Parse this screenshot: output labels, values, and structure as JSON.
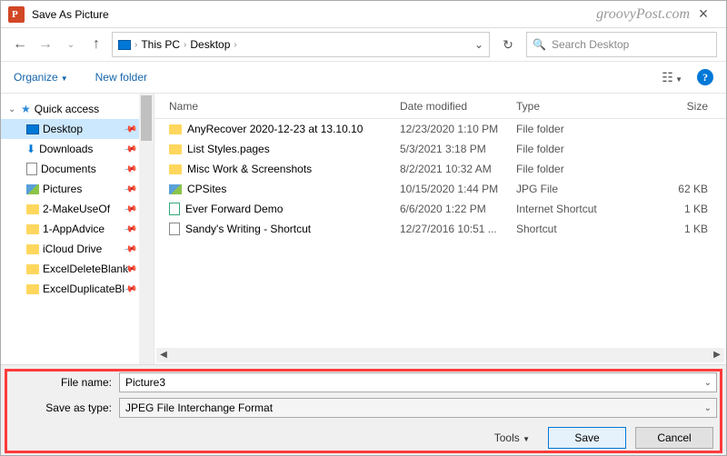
{
  "watermark": "groovyPost.com",
  "window": {
    "title": "Save As Picture"
  },
  "nav": {
    "path_root": "This PC",
    "path_leaf": "Desktop",
    "search_placeholder": "Search Desktop"
  },
  "toolbar": {
    "organize": "Organize",
    "newfolder": "New folder"
  },
  "sidebar": {
    "quick": "Quick access",
    "items": [
      {
        "label": "Desktop",
        "icon": "monitor",
        "selected": true,
        "pinned": true
      },
      {
        "label": "Downloads",
        "icon": "arrow",
        "pinned": true
      },
      {
        "label": "Documents",
        "icon": "doc",
        "pinned": true
      },
      {
        "label": "Pictures",
        "icon": "pic",
        "pinned": true
      },
      {
        "label": "2-MakeUseOf",
        "icon": "fld",
        "pinned": true
      },
      {
        "label": "1-AppAdvice",
        "icon": "fld",
        "pinned": true
      },
      {
        "label": "iCloud Drive",
        "icon": "fld",
        "pinned": true
      },
      {
        "label": "ExcelDeleteBlank",
        "icon": "fld",
        "pinned": true
      },
      {
        "label": "ExcelDuplicateBl",
        "icon": "fld",
        "pinned": true
      }
    ]
  },
  "columns": {
    "name": "Name",
    "date": "Date modified",
    "type": "Type",
    "size": "Size"
  },
  "files": [
    {
      "name": "AnyRecover 2020-12-23 at 13.10.10",
      "date": "12/23/2020 1:10 PM",
      "type": "File folder",
      "size": "",
      "icon": "fld"
    },
    {
      "name": "List Styles.pages",
      "date": "5/3/2021 3:18 PM",
      "type": "File folder",
      "size": "",
      "icon": "fld"
    },
    {
      "name": "Misc Work & Screenshots",
      "date": "8/2/2021 10:32 AM",
      "type": "File folder",
      "size": "",
      "icon": "fld"
    },
    {
      "name": "CPSites",
      "date": "10/15/2020 1:44 PM",
      "type": "JPG File",
      "size": "62 KB",
      "icon": "img"
    },
    {
      "name": "Ever Forward Demo",
      "date": "6/6/2020 1:22 PM",
      "type": "Internet Shortcut",
      "size": "1 KB",
      "icon": "url"
    },
    {
      "name": "Sandy's Writing - Shortcut",
      "date": "12/27/2016 10:51 ...",
      "type": "Shortcut",
      "size": "1 KB",
      "icon": "lnk"
    }
  ],
  "form": {
    "filename_label": "File name:",
    "filename_value": "Picture3",
    "type_label": "Save as type:",
    "type_value": "JPEG File Interchange Format",
    "tools": "Tools",
    "save": "Save",
    "cancel": "Cancel"
  }
}
